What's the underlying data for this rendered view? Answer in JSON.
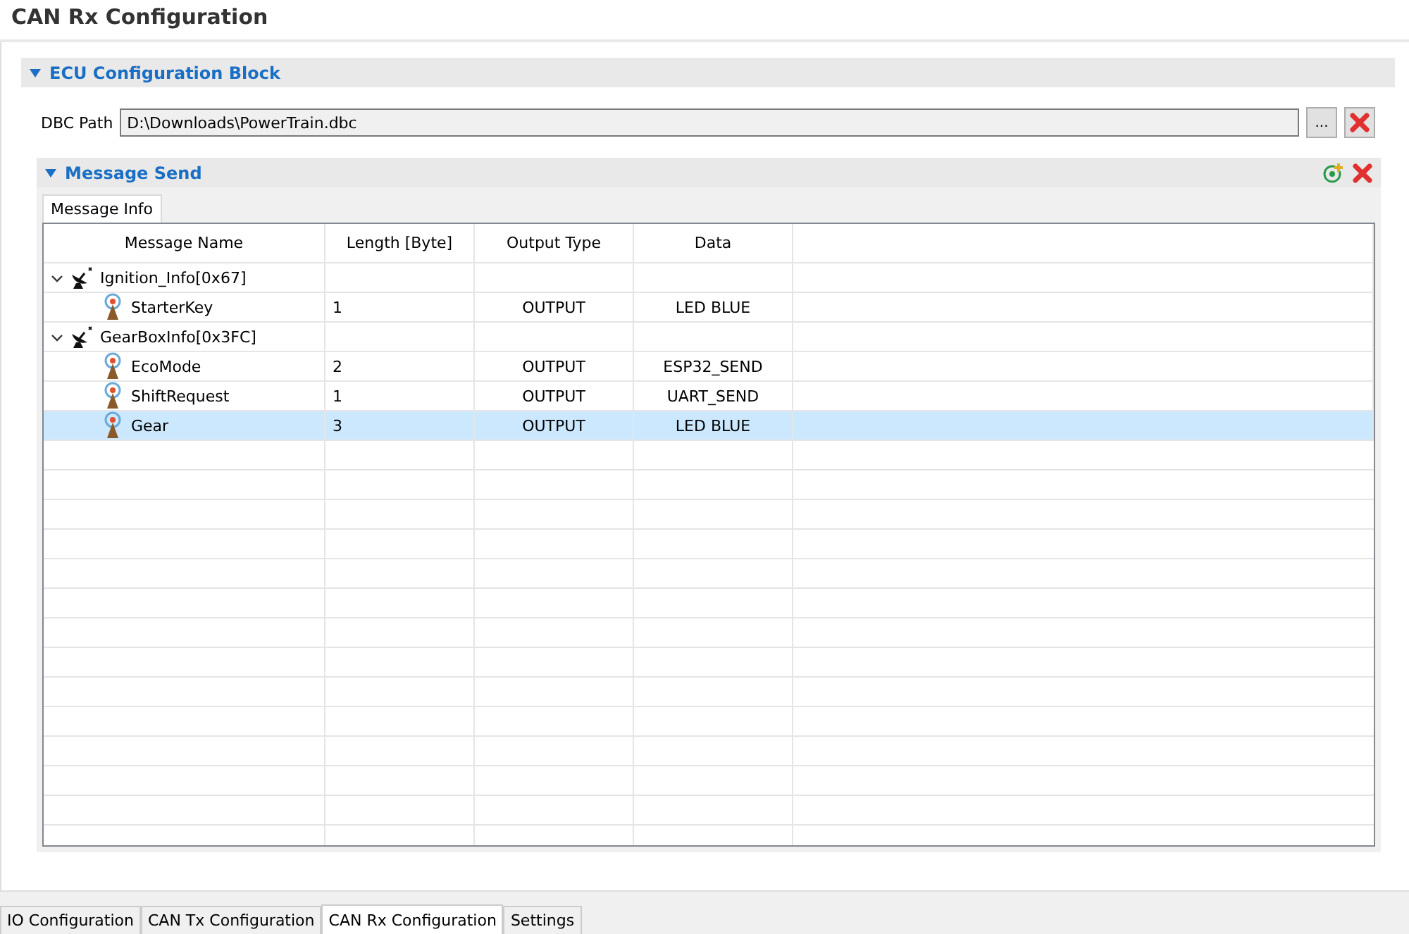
{
  "title": "CAN Rx Configuration",
  "ecu_section": {
    "title": "ECU Configuration Block",
    "expanded": true,
    "dbc_path": {
      "label": "DBC Path",
      "value": "D:\\Downloads\\PowerTrain.dbc",
      "browse_button": "..."
    },
    "message_section": {
      "title": "Message Send",
      "expanded": true,
      "tabs": [
        {
          "label": "Message Info",
          "selected": true
        }
      ],
      "table": {
        "columns": [
          "Message Name",
          "Length [Byte]",
          "Output Type",
          "Data"
        ],
        "rows": [
          {
            "name": "Ignition_Info[0x67]",
            "expanded": true,
            "selected": false,
            "children": [
              {
                "name": "StarterKey",
                "length": "1",
                "output_type": "OUTPUT",
                "data": "LED BLUE",
                "selected": false
              }
            ]
          },
          {
            "name": "GearBoxInfo[0x3FC]",
            "expanded": true,
            "selected": false,
            "children": [
              {
                "name": "EcoMode",
                "length": "2",
                "output_type": "OUTPUT",
                "data": "ESP32_SEND",
                "selected": false
              },
              {
                "name": "ShiftRequest",
                "length": "1",
                "output_type": "OUTPUT",
                "data": "UART_SEND",
                "selected": false
              },
              {
                "name": "Gear",
                "length": "3",
                "output_type": "OUTPUT",
                "data": "LED BLUE",
                "selected": true
              }
            ]
          }
        ]
      }
    }
  },
  "bottom_tabs": [
    {
      "label": "IO Configuration",
      "selected": false
    },
    {
      "label": "CAN Tx Configuration",
      "selected": false
    },
    {
      "label": "CAN Rx Configuration",
      "selected": true
    },
    {
      "label": "Settings",
      "selected": false
    }
  ]
}
